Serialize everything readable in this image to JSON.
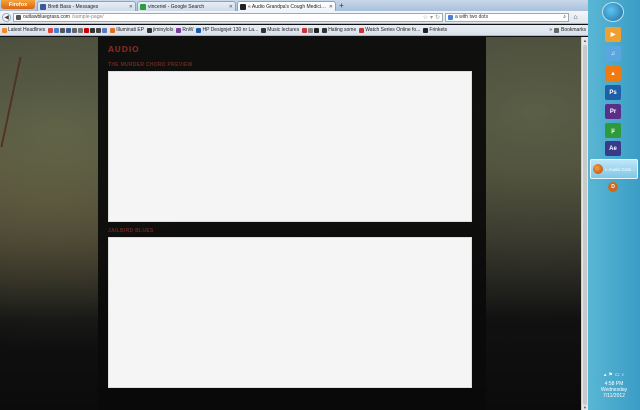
{
  "browser": {
    "app_button": "Firefox",
    "tabs": [
      {
        "label": "Brett Bass - Messages",
        "color": "#3b5998"
      },
      {
        "label": "vinceriel - Google Search",
        "color": "#2a9d3c"
      },
      {
        "label": "« Audio Grandpa's Cough Medicine ...",
        "color": "#222222",
        "active": true
      }
    ],
    "new_tab": "+",
    "url_host": "outlawbluegrass.com",
    "url_path": "/sample-page/",
    "search_value": "a with two dots",
    "bookmarks": [
      "Latest Headlines",
      "Illuminati EP",
      "jiminylols",
      "RnW",
      "HP Designjet 130 nr La...",
      "Music lectures",
      "Hating some",
      "Watch Series Online fo...",
      "Frinkets"
    ],
    "bookmarks_folder": "Bookmarks",
    "bookmarks_more": "»"
  },
  "page": {
    "section_title": "AUDIO",
    "player1_label": "THE MURDER CHORD PREVIEW",
    "player2_label": "JAILBIRD BLUES"
  },
  "taskbar": {
    "active_window": "« Audio Gran...",
    "time": "4:58 PM",
    "day": "Wednesday",
    "date": "7/11/2012",
    "icons": [
      {
        "name": "media-player",
        "color": "#f0a030",
        "glyph": "▶"
      },
      {
        "name": "itunes",
        "color": "#5aa6e0",
        "glyph": "♫"
      },
      {
        "name": "vlc",
        "color": "#f07a10",
        "glyph": "▲"
      },
      {
        "name": "photoshop",
        "color": "#1f5fa8",
        "glyph": "Ps"
      },
      {
        "name": "premiere",
        "color": "#5a2f8a",
        "glyph": "Pr"
      },
      {
        "name": "utorrent",
        "color": "#2f9a3a",
        "glyph": "µ"
      },
      {
        "name": "after-effects",
        "color": "#3a3a8a",
        "glyph": "Ae"
      }
    ]
  }
}
